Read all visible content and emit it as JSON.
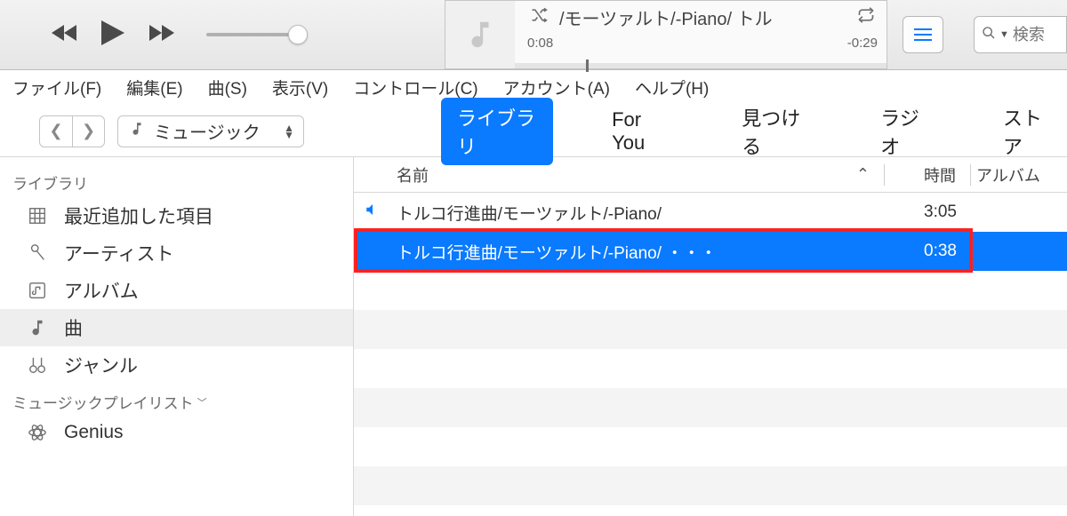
{
  "player": {
    "now_playing_title": "/モーツァルト/-Piano/ トル",
    "elapsed": "0:08",
    "remaining": "-0:29"
  },
  "search": {
    "placeholder": "検索"
  },
  "menubar": {
    "file": "ファイル(F)",
    "edit": "編集(E)",
    "song": "曲(S)",
    "view": "表示(V)",
    "controls": "コントロール(C)",
    "account": "アカウント(A)",
    "help": "ヘルプ(H)"
  },
  "nav": {
    "library_selector": "ミュージック",
    "tabs": {
      "library": "ライブラリ",
      "for_you": "For You",
      "browse": "見つける",
      "radio": "ラジオ",
      "store": "ストア"
    }
  },
  "sidebar": {
    "header_library": "ライブラリ",
    "recently_added": "最近追加した項目",
    "artists": "アーティスト",
    "albums": "アルバム",
    "songs": "曲",
    "genres": "ジャンル",
    "header_playlists": "ミュージックプレイリスト",
    "genius": "Genius"
  },
  "columns": {
    "name": "名前",
    "time": "時間",
    "album": "アルバム"
  },
  "tracks": [
    {
      "name": "トルコ行進曲/モーツァルト/-Piano/",
      "time": "3:05",
      "playing": true,
      "selected": false
    },
    {
      "name": "トルコ行進曲/モーツァルト/-Piano/ ・・・",
      "time": "0:38",
      "playing": false,
      "selected": true
    }
  ]
}
